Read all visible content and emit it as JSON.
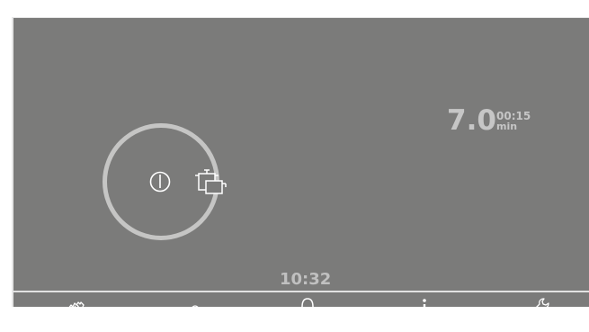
{
  "hob": {
    "power_level": "7.0",
    "timer_value": "00:15",
    "timer_unit": "min"
  },
  "status": {
    "clock": "10:32"
  },
  "toolbar": {
    "items": [
      {
        "icon": "wipe-protection-hand-icon"
      },
      {
        "icon": "key-lock-icon"
      },
      {
        "icon": "bell-icon"
      },
      {
        "icon": "info-icon"
      },
      {
        "icon": "wrench-icon"
      }
    ]
  },
  "colors": {
    "screen_bg": "#7b7b7a",
    "ring": "#c5c5c4",
    "text": "#c6c6c6",
    "icon": "#ffffff"
  }
}
